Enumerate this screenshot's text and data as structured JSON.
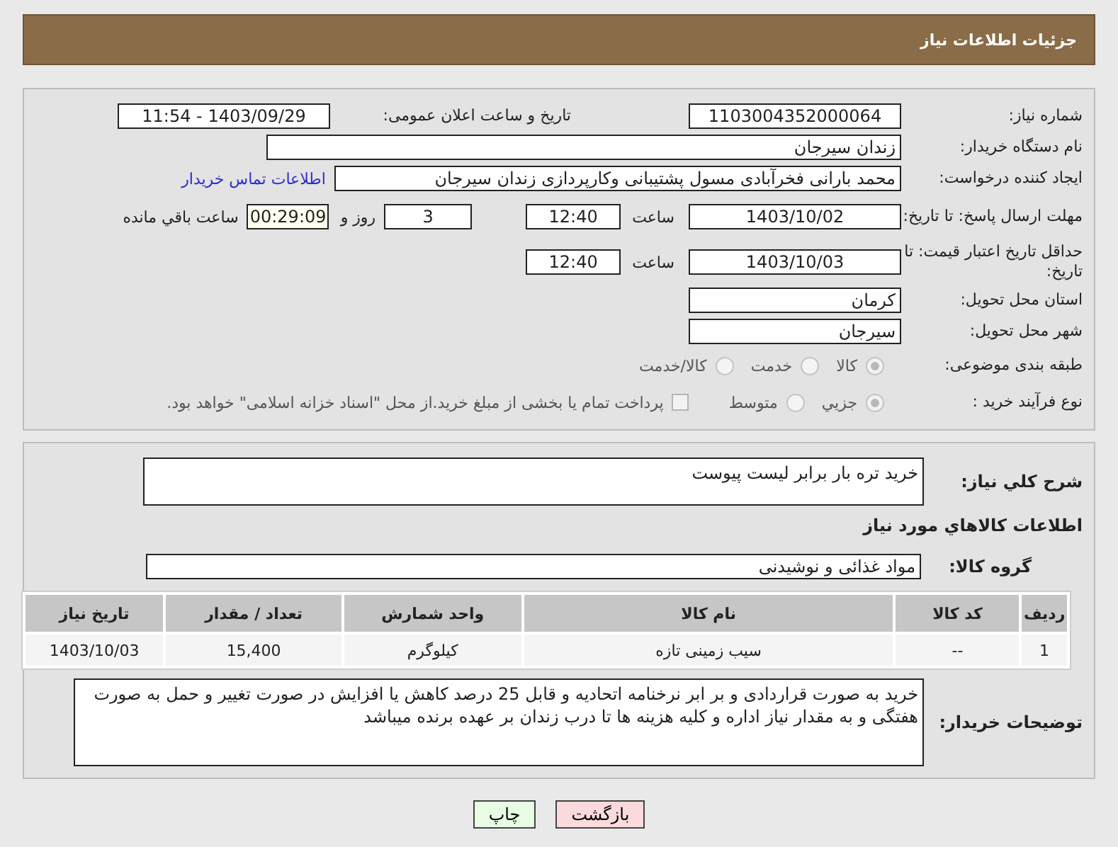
{
  "header": {
    "title": "جزئیات اطلاعات نیاز"
  },
  "need_number": {
    "label": "شماره نیاز:",
    "value": "1103004352000064"
  },
  "announce": {
    "label": "تاریخ و ساعت اعلان عمومی:",
    "value": "1403/09/29 - 11:54"
  },
  "buyer_org": {
    "label": "نام دستگاه خریدار:",
    "value": "زندان سیرجان"
  },
  "requester": {
    "label": "ایجاد کننده درخواست:",
    "value": "محمد بارانی فخرآبادی مسول پشتیبانی وکارپردازی زندان سیرجان",
    "link": "اطلاعات تماس خریدار"
  },
  "deadline": {
    "label": "مهلت ارسال پاسخ: تا تاریخ:",
    "date": "1403/10/02",
    "time_label": "ساعت",
    "time": "12:40",
    "days": "3",
    "days_label": "روز و",
    "remaining": "00:29:09",
    "remaining_label": "ساعت باقي مانده"
  },
  "validity": {
    "label": "حداقل تاریخ اعتبار قیمت: تا تاریخ:",
    "date": "1403/10/03",
    "time_label": "ساعت",
    "time": "12:40"
  },
  "province": {
    "label": "استان محل تحویل:",
    "value": "کرمان"
  },
  "city": {
    "label": "شهر محل تحویل:",
    "value": "سیرجان"
  },
  "category": {
    "label": "طبقه بندی موضوعی:",
    "options": [
      {
        "label": "کالا",
        "selected": true
      },
      {
        "label": "خدمت",
        "selected": false
      },
      {
        "label": "کالا/خدمت",
        "selected": false
      }
    ]
  },
  "process": {
    "label": "نوع فرآیند خرید :",
    "options": [
      {
        "label": "جزیي",
        "selected": true
      },
      {
        "label": "متوسط",
        "selected": false
      }
    ],
    "payment": {
      "label": "پرداخت تمام یا بخشی از مبلغ خرید.از محل \"اسناد خزانه اسلامی\" خواهد بود.",
      "checked": false
    }
  },
  "description": {
    "label": "شرح کلي نیاز:",
    "value": "خرید تره بار برابر  لیست پیوست"
  },
  "items_heading": "اطلاعات کالاهاي مورد نیاز",
  "goods_group": {
    "label": "گروه کالا:",
    "value": "مواد غذائی و نوشیدنی"
  },
  "table": {
    "columns": [
      "ردیف",
      "کد کالا",
      "نام کالا",
      "واحد شمارش",
      "تعداد / مقدار",
      "تاریخ نیاز"
    ],
    "rows": [
      [
        "1",
        "--",
        "سیب زمینی تازه",
        "کیلوگرم",
        "15,400",
        "1403/10/03"
      ]
    ]
  },
  "buyer_notes": {
    "label": "توضیحات خریدار:",
    "value": "خرید به صورت قراردادی و بر ابر نرخنامه اتحادیه و قابل 25 درصد کاهش یا افزایش در صورت تغییر و حمل به صورت هفتگی و به مقدار نیاز اداره و کلیه هزینه ها تا درب زندان بر عهده برنده میباشد"
  },
  "buttons": [
    {
      "label": "بازگشت",
      "kind": "back"
    },
    {
      "label": "چاپ",
      "kind": "print"
    }
  ]
}
